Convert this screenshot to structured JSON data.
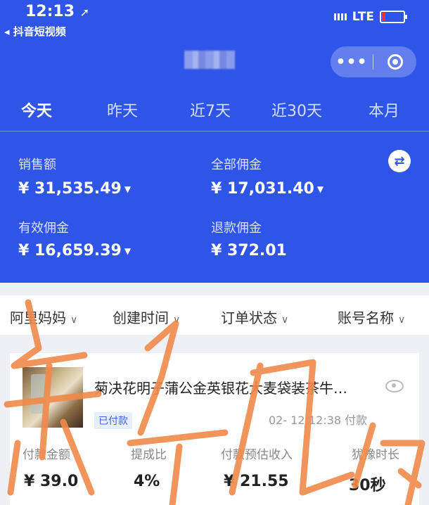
{
  "status_bar": {
    "time": "12:13",
    "location_arrow": "➚",
    "network": "LTE",
    "back_app": "◂ 抖音短视频"
  },
  "nav": {
    "more_icon": "•••",
    "close_icon": "target-circle-icon"
  },
  "tabs": [
    "今天",
    "昨天",
    "近7天",
    "近30天",
    "本月"
  ],
  "summary": {
    "sales_label": "销售额",
    "sales_value": "¥ 31,535.49",
    "total_commission_label": "全部佣金",
    "total_commission_value": "¥ 17,031.40",
    "valid_commission_label": "有效佣金",
    "valid_commission_value": "¥ 16,659.39",
    "refund_commission_label": "退款佣金",
    "refund_commission_value": "¥ 372.01",
    "caret": "▼"
  },
  "filters": [
    {
      "label": "阿里妈妈",
      "chev": "∨"
    },
    {
      "label": "创建时间",
      "chev": "∨"
    },
    {
      "label": "订单状态",
      "chev": "∨"
    },
    {
      "label": "账号名称",
      "chev": "∨"
    }
  ],
  "order": {
    "title": "菊决花明子蒲公金英银花大麦袋装茶牛…",
    "status": "已付款",
    "time": "02-  12:12:38 付款",
    "metrics": [
      {
        "label": "付款金额",
        "value": "¥ 39.0"
      },
      {
        "label": "提成比",
        "value": "4%"
      },
      {
        "label": "付款预估收入",
        "value": "¥ 21.55"
      },
      {
        "label": "犹豫时长",
        "value": "30秒"
      }
    ]
  },
  "colors": {
    "primary": "#2f55e8",
    "scribble": "#f08a4b"
  }
}
